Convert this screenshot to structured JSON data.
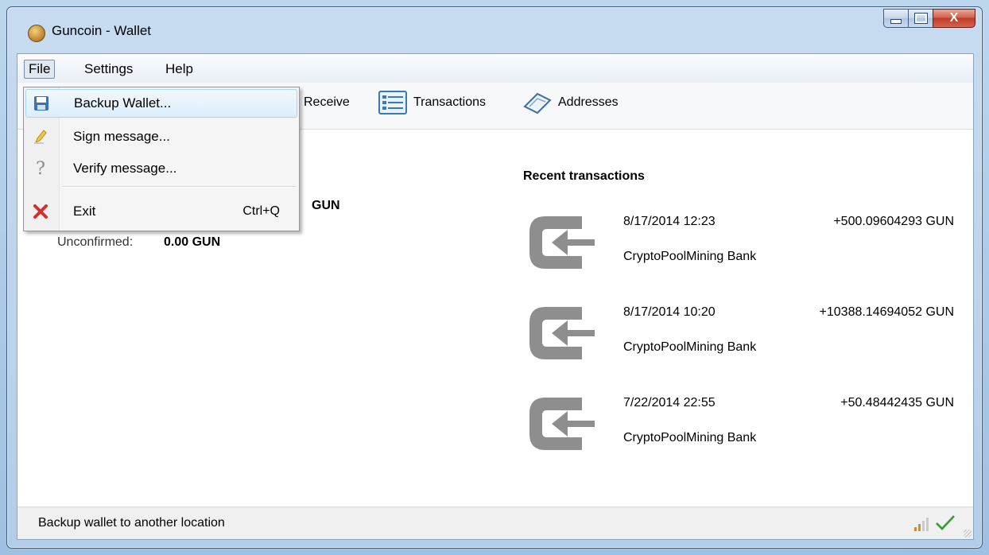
{
  "window": {
    "title": "Guncoin - Wallet",
    "close_glyph": "X"
  },
  "menubar": {
    "items": [
      {
        "label": "File"
      },
      {
        "label": "Settings"
      },
      {
        "label": "Help"
      }
    ]
  },
  "toolbar": {
    "items": [
      {
        "label": "Receive",
        "icon": "receive-icon"
      },
      {
        "label": "Transactions",
        "icon": "transactions-list-icon"
      },
      {
        "label": "Addresses",
        "icon": "address-book-icon"
      }
    ]
  },
  "file_menu": {
    "items": [
      {
        "label": "Backup Wallet...",
        "icon": "floppy-disk-icon",
        "shortcut": ""
      },
      {
        "label": "Sign message...",
        "icon": "pen-icon",
        "shortcut": ""
      },
      {
        "label": "Verify message...",
        "icon": "question-mark-icon",
        "shortcut": ""
      },
      {
        "label": "Exit",
        "icon": "red-x-icon",
        "shortcut": "Ctrl+Q"
      }
    ]
  },
  "overview": {
    "balance_suffix": "GUN",
    "unconfirmed_label": "Unconfirmed:",
    "unconfirmed_value": "0.00 GUN",
    "recent_title": "Recent transactions",
    "transactions": [
      {
        "date": "8/17/2014 12:23",
        "amount": "+500.09604293 GUN",
        "label": "CryptoPoolMining Bank"
      },
      {
        "date": "8/17/2014 10:20",
        "amount": "+10388.14694052 GUN",
        "label": "CryptoPoolMining Bank"
      },
      {
        "date": "7/22/2014 22:55",
        "amount": "+50.48442435 GUN",
        "label": "CryptoPoolMining Bank"
      }
    ]
  },
  "status_bar": {
    "text": "Backup wallet to another location",
    "icons": [
      "connection-signal-icon",
      "synced-checkmark-icon"
    ]
  },
  "colors": {
    "titlebar": "#c7dbf0",
    "close_button": "#c0392b",
    "menu_highlight": "#dceefb",
    "tx_icon": "#8a8a8a"
  }
}
